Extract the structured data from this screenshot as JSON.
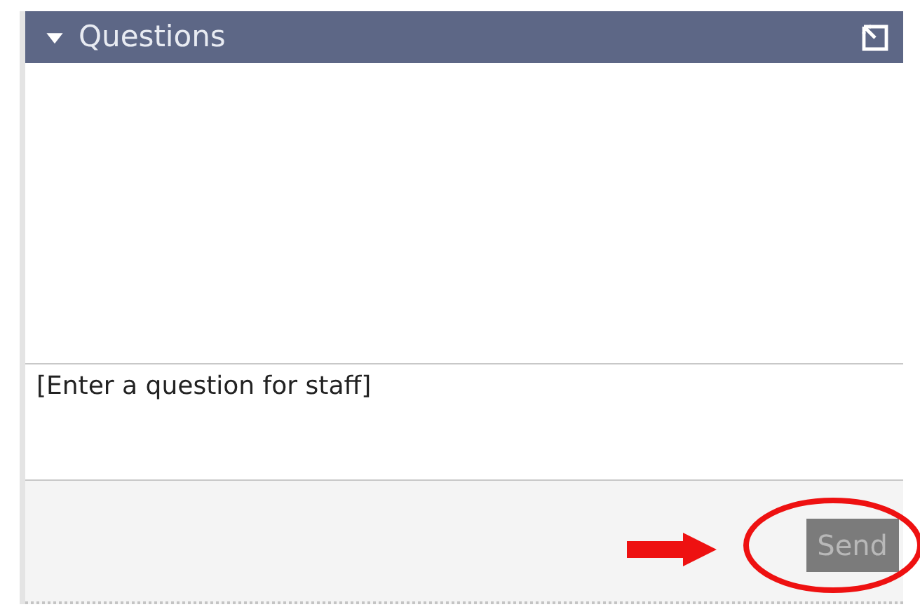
{
  "panel": {
    "title": "Questions",
    "expanded": true
  },
  "question_field": {
    "placeholder": "[Enter a question for staff]"
  },
  "send_button": {
    "label": "Send",
    "disabled": true
  },
  "arrow_annotation": {
    "color": "#ee1111"
  },
  "ellipse_annotation": {
    "color": "#ee1111"
  }
}
